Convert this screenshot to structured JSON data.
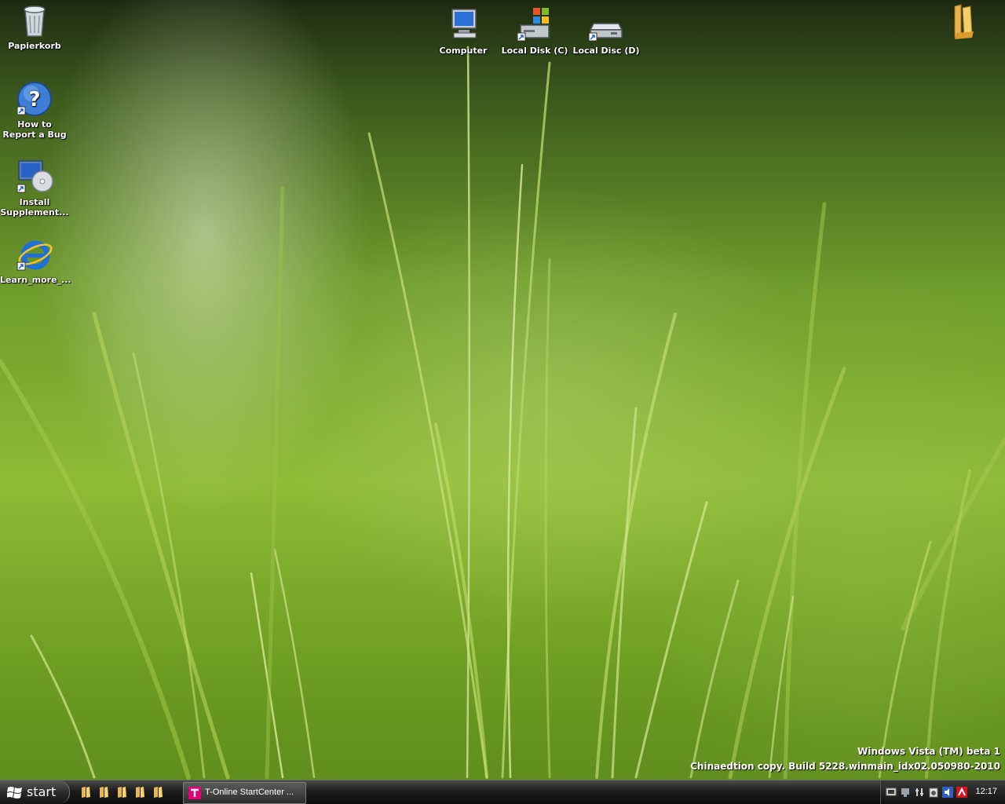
{
  "desktop_icons": {
    "recycle_bin": "Papierkorb",
    "report_bug": "How to Report a Bug",
    "install_supplement": "Install Supplement...",
    "learn_more": "Learn_more_...",
    "computer": "Computer",
    "local_disk_c": "Local Disk (C)",
    "local_disc_d": "Local Disc (D)"
  },
  "watermark": {
    "line1": "Windows Vista (TM) beta 1",
    "line2": "Chinaedtion copy. Build 5228.winmain_idx02.050980-2010"
  },
  "taskbar": {
    "start_label": "start",
    "quick_launch": [
      "folder-icon",
      "folder-icon",
      "folder-icon",
      "folder-icon",
      "folder-icon"
    ],
    "tasks": [
      {
        "label": "T-Online StartCenter ...",
        "icon": "t-online-icon"
      }
    ],
    "tray_icons": [
      "network-icon",
      "display-icon",
      "connection-icon",
      "battery-icon",
      "volume-icon",
      "antivir-icon"
    ],
    "clock": "12:17"
  },
  "colors": {
    "taskbar": "#1c1c1c",
    "accent": "#8fbb35",
    "text": "#ffffff"
  }
}
